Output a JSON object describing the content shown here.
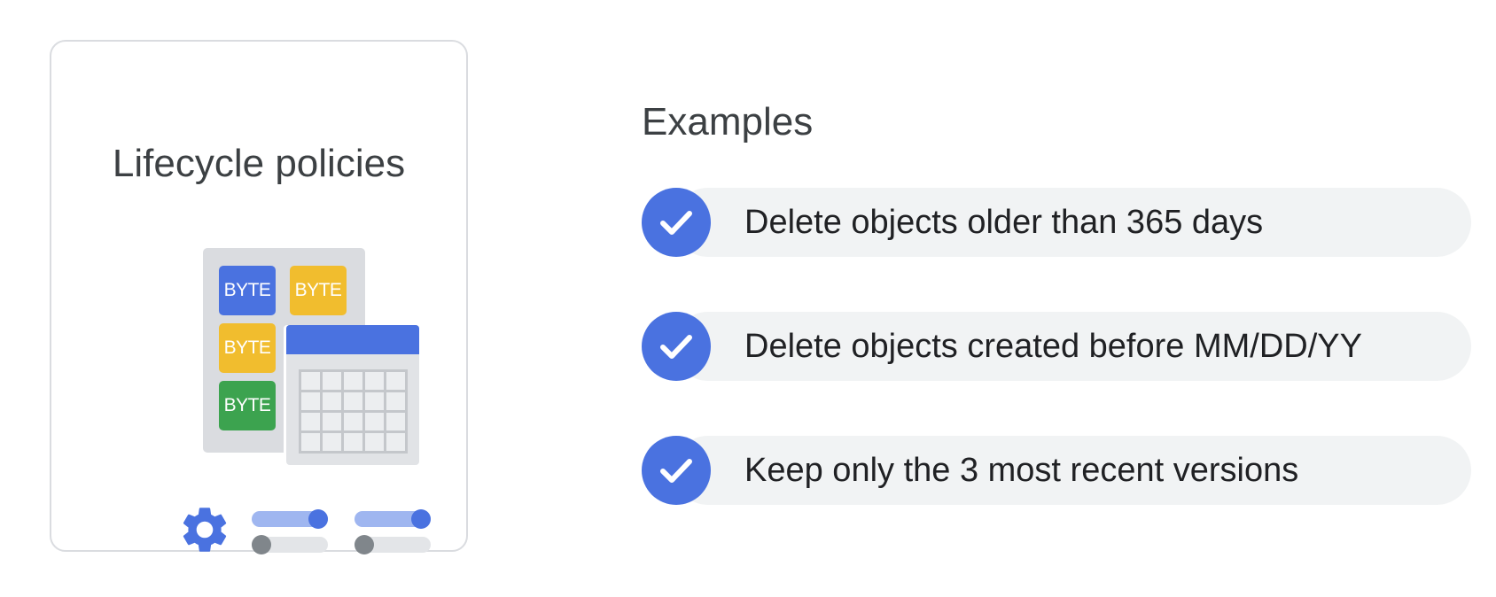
{
  "card": {
    "title": "Lifecycle policies",
    "byte_labels": [
      "BYTE",
      "BYTE",
      "BYTE",
      "BYTE"
    ],
    "icon": "gear-icon"
  },
  "examples": {
    "title": "Examples",
    "items": [
      {
        "text": "Delete objects older than 365 days",
        "icon": "check-icon"
      },
      {
        "text": "Delete objects created before MM/DD/YY",
        "icon": "check-icon"
      },
      {
        "text": "Keep only the 3 most recent versions",
        "icon": "check-icon"
      }
    ]
  },
  "colors": {
    "accent_blue": "#4a72e0",
    "yellow": "#f1bd2e",
    "green": "#3ca34f",
    "pill_bg": "#f1f3f4",
    "card_border": "#dadce0"
  }
}
